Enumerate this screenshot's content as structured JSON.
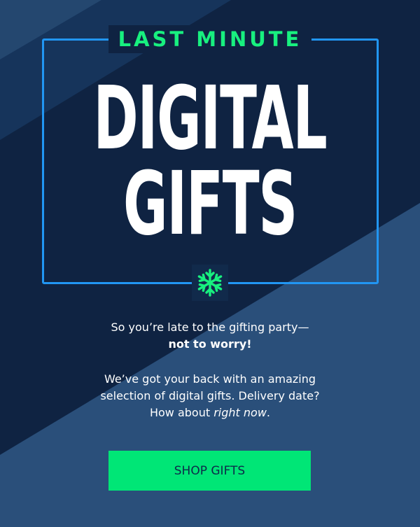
{
  "hero": {
    "eyebrow": "LAST MINUTE",
    "title_line1": "DIGITAL",
    "title_line2": "GIFTS"
  },
  "icons": {
    "divider_icon": "snowflake-icon"
  },
  "copy": {
    "intro": "So you’re late to the gifting party—",
    "intro_bold": "not to worry!",
    "body_line1": "We’ve got your back with an amazing",
    "body_line2": "selection of digital gifts. Delivery date?",
    "body_line3_prefix": "How about ",
    "body_line3_italic": "right now",
    "body_line3_suffix": "."
  },
  "cta": {
    "label": "SHOP GIFTS"
  },
  "colors": {
    "accent_green": "#18f07f",
    "button_green": "#00e676",
    "frame_blue": "#2196f3",
    "navy_dark": "#0f2342",
    "navy_light": "#2a4f7a"
  }
}
